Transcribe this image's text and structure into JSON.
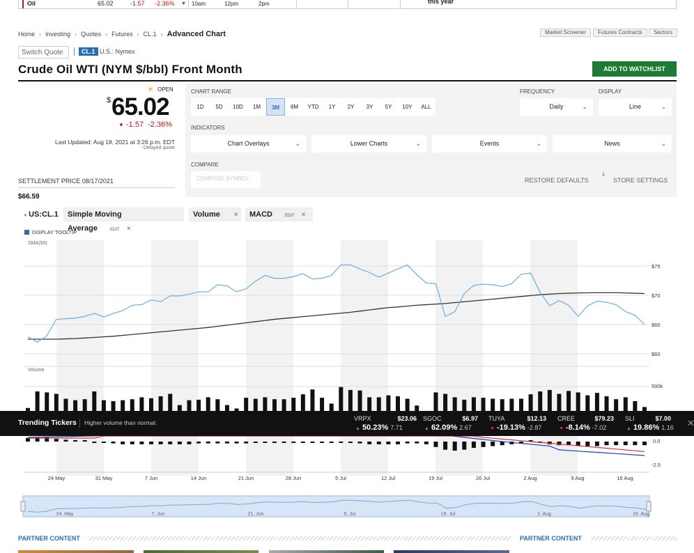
{
  "top_strip": {
    "name": "Oil",
    "price": "65.02",
    "change": "-1.57",
    "percent": "-2.36%",
    "times": [
      "10am",
      "12pm",
      "2pm"
    ],
    "note": "this year"
  },
  "breadcrumb": [
    "Home",
    "Investing",
    "Quotes",
    "Futures",
    "CL.1",
    "Advanced Chart"
  ],
  "top_links": [
    "Market Screener",
    "Futures Contracts",
    "Sectors"
  ],
  "switch_quote": "Switch Quote",
  "symbol": "CL.1",
  "exchange": "U.S.: Nymex",
  "title": "Crude Oil WTI (NYM $/bbl) Front Month",
  "watchlist_button": "ADD TO WATCHLIST",
  "status": "OPEN",
  "currency": "$",
  "price": "65.02",
  "change": "-1.57",
  "change_pct": "-2.36%",
  "last_updated": "Last Updated: Aug 18, 2021 at 3:26 p.m. EDT",
  "delayed": "Delayed quote",
  "settlement_label": "SETTLEMENT PRICE 08/17/2021",
  "settlement_value": "$66.59",
  "controls": {
    "chart_range_label": "CHART RANGE",
    "ranges": [
      "1D",
      "5D",
      "10D",
      "1M",
      "3M",
      "6M",
      "YTD",
      "1Y",
      "2Y",
      "3Y",
      "5Y",
      "10Y",
      "ALL"
    ],
    "active_range": "3M",
    "frequency_label": "FREQUENCY",
    "frequency": "Daily",
    "display_label": "DISPLAY",
    "display": "Line",
    "indicators_label": "INDICATORS",
    "indicators": [
      "Chart Overlays",
      "Lower Charts",
      "Events",
      "News"
    ],
    "compare_label": "COMPARE",
    "compare_placeholder": "COMPARE SYMBOL",
    "restore": "RESTORE DEFAULTS",
    "store": "STORE SETTINGS"
  },
  "chips": {
    "symbol": "US:CL.1",
    "sma": "Simple Moving Average",
    "volume": "Volume",
    "macd": "MACD",
    "edit": "EDIT",
    "close": "×"
  },
  "display_tooltip": "DISPLAY TOOLTIP",
  "sma_label": "SMA(50)",
  "volume_label": "Volume",
  "trending": {
    "title": "Trending Tickers",
    "subtitle": "Higher volume than normal.",
    "tickers": [
      {
        "sym": "VRPX",
        "price": "$23.06",
        "pct": "50.23%",
        "chg": "7.71",
        "dir": "up"
      },
      {
        "sym": "SGOC",
        "price": "$6.97",
        "pct": "62.09%",
        "chg": "2.67",
        "dir": "up"
      },
      {
        "sym": "TUYA",
        "price": "$12.13",
        "pct": "-19.13%",
        "chg": "-2.87",
        "dir": "dn"
      },
      {
        "sym": "CREE",
        "price": "$79.23",
        "pct": "-8.14%",
        "chg": "-7.02",
        "dir": "dn"
      },
      {
        "sym": "SLI",
        "price": "$7.00",
        "pct": "19.86%",
        "chg": "1.16",
        "dir": "up"
      }
    ]
  },
  "partner_left": "PARTNER CONTENT",
  "partner_right": "PARTNER CONTENT",
  "chart_data": {
    "type": "line",
    "x_ticks": [
      "24 May",
      "31 May",
      "7 Jun",
      "14 Jun",
      "21 Jun",
      "28 Jun",
      "5 Jul",
      "12 Jul",
      "19 Jul",
      "26 Jul",
      "2 Aug",
      "9 Aug",
      "16 Aug"
    ],
    "navigator_ticks": [
      "24. May",
      "7. Jun",
      "21. Jun",
      "5. Jul",
      "19. Jul",
      "2. Aug",
      "16. Aug"
    ],
    "y_ticks": [
      "$75",
      "$70",
      "$65",
      "$60"
    ],
    "ylim": [
      60,
      75
    ],
    "price": [
      62.9,
      62.0,
      63.1,
      65.9,
      66.0,
      66.1,
      66.4,
      66.9,
      66.3,
      66.9,
      67.4,
      68.3,
      68.4,
      69.2,
      68.9,
      69.9,
      69.9,
      70.2,
      70.6,
      70.6,
      71.8,
      71.6,
      70.6,
      71.1,
      72.4,
      73.4,
      72.9,
      72.9,
      73.2,
      73.7,
      72.8,
      72.9,
      73.4,
      75.2,
      75.2,
      74.5,
      73.9,
      73.1,
      73.8,
      74.5,
      75.2,
      73.5,
      72.1,
      72.0,
      66.4,
      67.2,
      70.3,
      71.7,
      71.9,
      71.8,
      71.5,
      72.0,
      73.6,
      73.8,
      70.5,
      68.2,
      69.1,
      68.3,
      66.4,
      68.2,
      69.0,
      68.8,
      68.4,
      67.2,
      66.6,
      65.0
    ],
    "sma": [
      62.5,
      62.5,
      62.5,
      62.5,
      62.55,
      62.6,
      62.7,
      62.8,
      62.9,
      63.0,
      63.15,
      63.3,
      63.45,
      63.6,
      63.75,
      63.9,
      64.05,
      64.2,
      64.35,
      64.5,
      64.7,
      64.9,
      65.1,
      65.3,
      65.5,
      65.7,
      65.9,
      66.05,
      66.2,
      66.35,
      66.5,
      66.65,
      66.8,
      66.95,
      67.1,
      67.3,
      67.5,
      67.7,
      67.9,
      68.0,
      68.15,
      68.3,
      68.4,
      68.5,
      68.6,
      68.75,
      68.9,
      69.05,
      69.2,
      69.35,
      69.5,
      69.65,
      69.8,
      69.95,
      70.1,
      70.2,
      70.3,
      70.35,
      70.4,
      70.42,
      70.45,
      70.45,
      70.45,
      70.4,
      70.35,
      70.3
    ],
    "volume": {
      "ticks": [
        "500k",
        "0k"
      ],
      "ylim": [
        0,
        550000
      ],
      "values": [
        60000,
        400000,
        380000,
        350000,
        250000,
        220000,
        240000,
        400000,
        220000,
        200000,
        220000,
        240000,
        280000,
        260000,
        300000,
        350000,
        120000,
        220000,
        230000,
        280000,
        240000,
        120000,
        50000,
        270000,
        250000,
        280000,
        240000,
        240000,
        270000,
        340000,
        440000,
        270000,
        150000,
        490000,
        430000,
        420000,
        280000,
        280000,
        320000,
        300000,
        250000,
        110000,
        0,
        380000,
        350000,
        280000,
        230000,
        280000,
        270000,
        250000,
        240000,
        250000,
        250000,
        340000,
        400000,
        430000,
        350000,
        410000,
        380000,
        320000,
        370000,
        300000,
        240000,
        280000,
        200000,
        80000
      ]
    },
    "macd": {
      "ticks": [
        "0.0",
        "-2.5"
      ],
      "ylim": [
        -3,
        1.5
      ]
    }
  }
}
